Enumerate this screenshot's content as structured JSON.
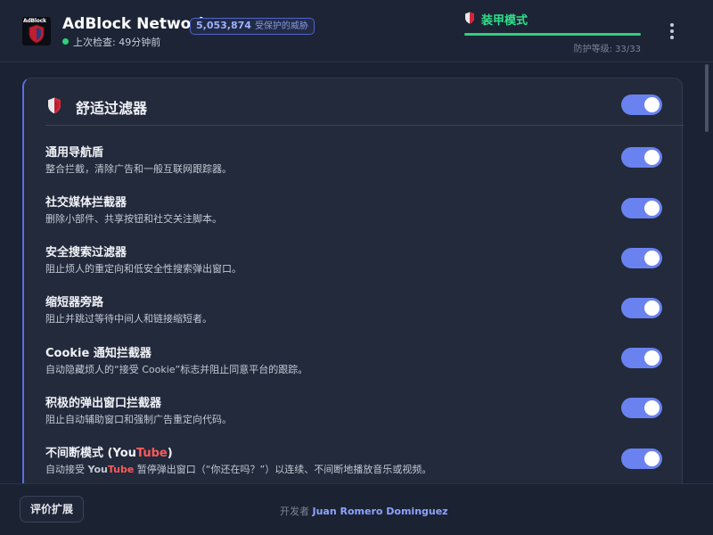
{
  "header": {
    "logo_text": "AdBlock",
    "app_title": "AdBlock Network",
    "blocked_count": "5,053,874",
    "blocked_label": "受保护的威胁",
    "last_check": "上次检查: 49分钟前",
    "mode_label": "装甲模式",
    "protection_level_text": "防护等级: 33/33",
    "protection_level": 33,
    "protection_max": 33
  },
  "card": {
    "title": "舒适过滤器",
    "master_toggle_on": true,
    "filters": [
      {
        "title": "通用导航盾",
        "description": "整合拦截，清除广告和一般互联网跟踪器。",
        "enabled": true
      },
      {
        "title": "社交媒体拦截器",
        "description": "删除小部件、共享按钮和社交关注脚本。",
        "enabled": true
      },
      {
        "title": "安全搜索过滤器",
        "description": "阻止烦人的重定向和低安全性搜索弹出窗口。",
        "enabled": true
      },
      {
        "title": "缩短器旁路",
        "description": "阻止并跳过等待中间人和链接缩短者。",
        "enabled": true
      },
      {
        "title": "Cookie 通知拦截器",
        "description": "自动隐藏烦人的“接受 Cookie”标志并阻止同意平台的跟踪。",
        "enabled": true
      },
      {
        "title": "积极的弹出窗口拦截器",
        "description": "阻止自动辅助窗口和强制广告重定向代码。",
        "enabled": true
      },
      {
        "title_pre": "不间断模式 (You",
        "title_hl": "Tube",
        "title_post": ")",
        "desc_pre": "自动接受 ",
        "desc_hl1": "You",
        "desc_hl2": "Tube",
        "desc_post": " 暂停弹出窗口（“你还在吗？”）以连续、不间断地播放音乐或视频。",
        "enabled": true
      }
    ]
  },
  "footer": {
    "rate_button": "评价扩展",
    "dev_prefix": "开发者",
    "dev_name": "Juan Romero Dominguez"
  },
  "colors": {
    "accent": "#6a82f0",
    "status_green": "#2fd07a",
    "youtube_red": "#ff5a5a",
    "background": "#1a2233"
  }
}
